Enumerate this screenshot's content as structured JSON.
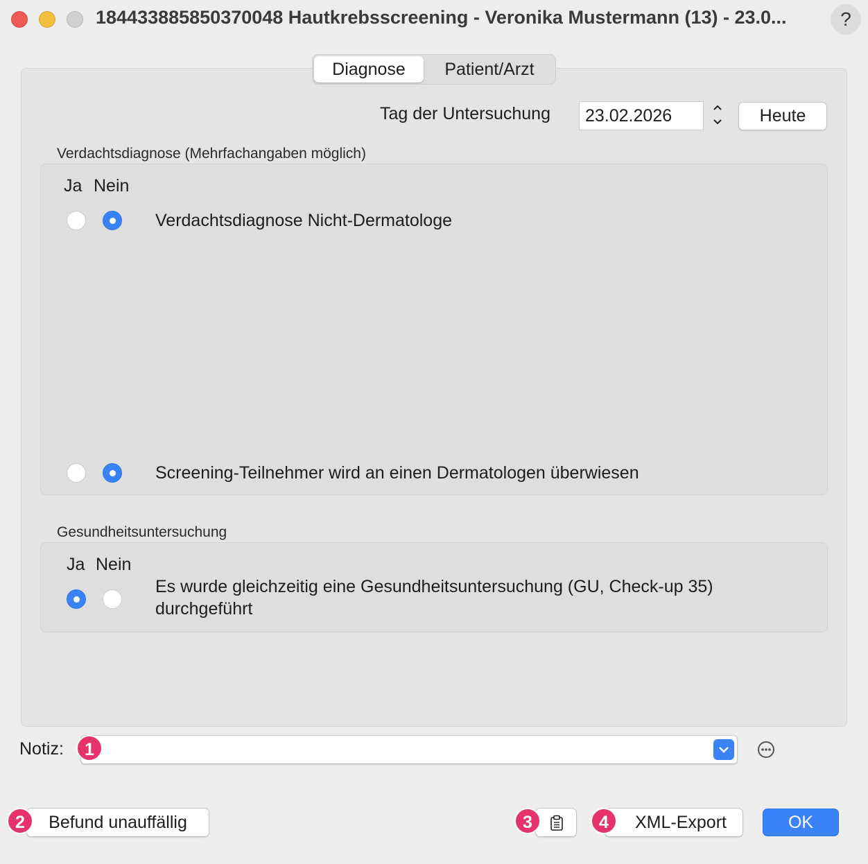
{
  "window": {
    "title": "184433885850370048 Hautkrebsscreening - Veronika Mustermann (13) - 23.0...",
    "help_label": "?"
  },
  "tabs": [
    {
      "label": "Diagnose",
      "selected": true
    },
    {
      "label": "Patient/Arzt",
      "selected": false
    }
  ],
  "exam_date": {
    "label": "Tag der Untersuchung",
    "value": "23.02.2026",
    "today_button": "Heute"
  },
  "verdacht": {
    "section_label": "Verdachtsdiagnose (Mehrfachangaben möglich)",
    "col_yes": "Ja",
    "col_no": "Nein",
    "rows": [
      {
        "text": "Verdachtsdiagnose Nicht-Dermatologe",
        "value": "Nein"
      },
      {
        "text": "Screening-Teilnehmer wird an einen Dermatologen überwiesen",
        "value": "Nein"
      }
    ]
  },
  "gu": {
    "section_label": "Gesundheitsuntersuchung",
    "col_yes": "Ja",
    "col_no": "Nein",
    "row_line1": "Es wurde gleichzeitig eine Gesundheitsuntersuchung (GU, Check-up 35)",
    "row_line2": "durchgeführt",
    "value": "Ja"
  },
  "notiz": {
    "label": "Notiz:",
    "value": ""
  },
  "footer": {
    "befund_button": "Befund unauffällig",
    "xml_button": "XML-Export",
    "ok_button": "OK"
  },
  "badges": [
    "1",
    "2",
    "3",
    "4"
  ],
  "colors": {
    "accent": "#3a82f7",
    "badge": "#e6336b"
  }
}
